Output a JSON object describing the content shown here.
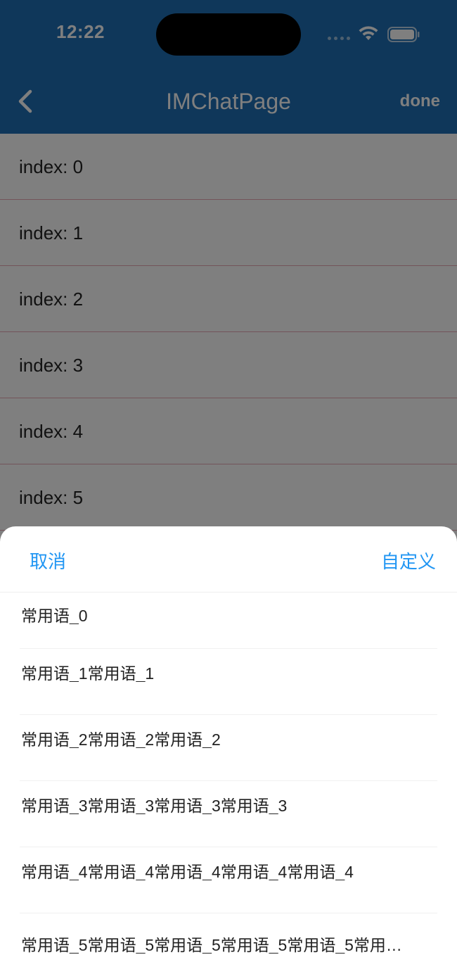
{
  "status_bar": {
    "time": "12:22",
    "icons": [
      "cellular-icon",
      "wifi-icon",
      "battery-icon"
    ]
  },
  "nav_bar": {
    "title": "IMChatPage",
    "back_icon": "chevron-left-icon",
    "done_label": "done"
  },
  "list": {
    "items": [
      "index: 0",
      "index: 1",
      "index: 2",
      "index: 3",
      "index: 4",
      "index: 5"
    ]
  },
  "sheet": {
    "cancel_label": "取消",
    "custom_label": "自定义",
    "phrases": [
      "常用语_0",
      "常用语_1常用语_1",
      "常用语_2常用语_2常用语_2",
      "常用语_3常用语_3常用语_3常用语_3",
      "常用语_4常用语_4常用语_4常用语_4常用语_4",
      "常用语_5常用语_5常用语_5常用语_5常用语_5常用…"
    ]
  },
  "colors": {
    "app_bar": "#1f6fb4",
    "accent": "#2196f3",
    "divider": "#e6a9b5"
  }
}
